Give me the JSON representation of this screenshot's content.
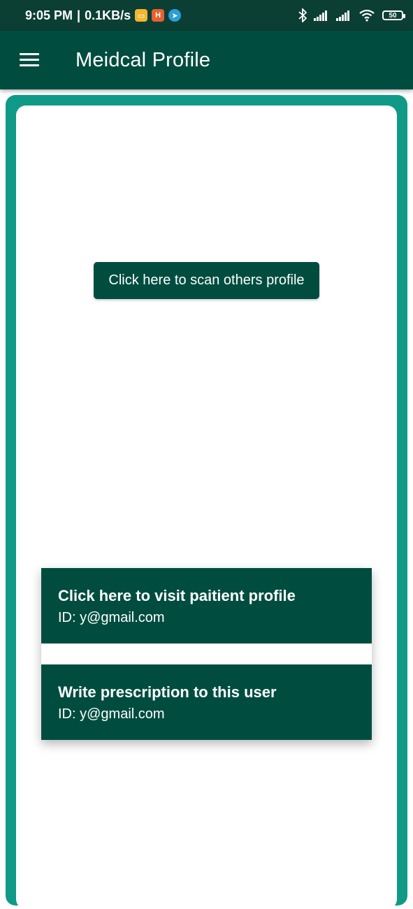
{
  "status_bar": {
    "time": "9:05 PM",
    "separator": "|",
    "speed": "0.1KB/s",
    "battery": "50",
    "icons": [
      "message-notification-icon",
      "h-app-notification-icon",
      "telegram-icon",
      "bluetooth-icon",
      "signal-icon",
      "signal-icon",
      "wifi-icon",
      "battery-icon"
    ],
    "colors": {
      "background": "#0b3f34"
    }
  },
  "app_bar": {
    "title": "Meidcal Profile",
    "menu_icon": "hamburger-menu-icon",
    "colors": {
      "background": "#004d40"
    }
  },
  "main": {
    "scan_button_label": "Click here to scan others profile",
    "items": [
      {
        "title": "Click here to visit paitient profile",
        "subtitle": "ID: y@gmail.com"
      },
      {
        "title": "Write prescription to this user",
        "subtitle": "ID: y@gmail.com"
      }
    ],
    "colors": {
      "frame": "#0f9a88",
      "primary": "#004d40",
      "card": "#ffffff"
    }
  }
}
